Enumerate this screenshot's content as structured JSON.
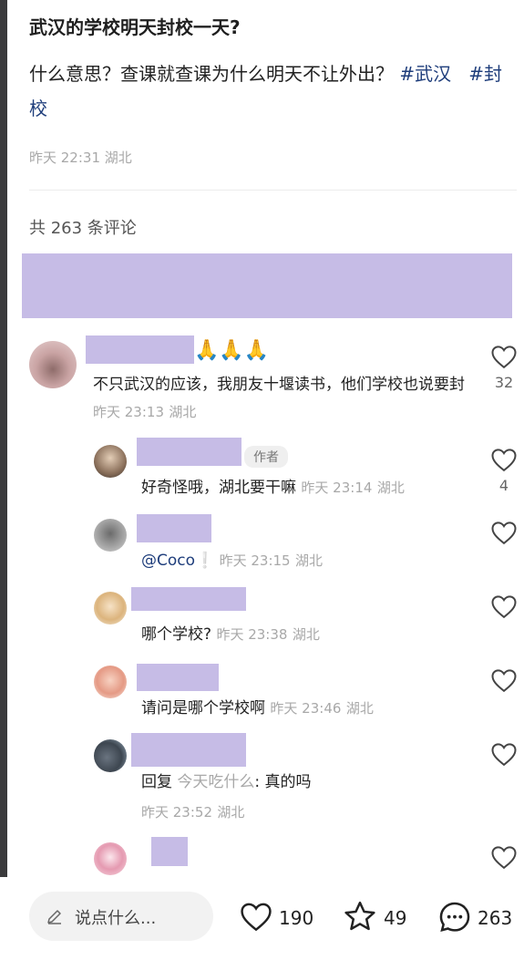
{
  "post": {
    "title": "武汉的学校明天封校一天?",
    "body_text": "什么意思？查课就查课为什么明天不让外出？",
    "tags": [
      "#武汉",
      "#封校"
    ],
    "time": "昨天 22:31",
    "location": "湖北"
  },
  "comments_header": "共 263 条评论",
  "comments": [
    {
      "name_suffix": "🙏🙏🙏",
      "text": "不只武汉的应该，我朋友十堰读书，他们学校也说要封",
      "time": "昨天 23:13",
      "location": "湖北",
      "likes": "32"
    },
    {
      "badge": "作者",
      "text": "好奇怪哦，湖北要干嘛",
      "time": "昨天 23:14",
      "location": "湖北",
      "likes": "4"
    },
    {
      "mention": "@Coco",
      "mention_suffix": "❕",
      "time": "昨天 23:15",
      "location": "湖北"
    },
    {
      "text": "哪个学校?",
      "time": "昨天 23:38",
      "location": "湖北"
    },
    {
      "text": "请问是哪个学校啊",
      "time": "昨天 23:46",
      "location": "湖北"
    },
    {
      "reply_label": "回复",
      "reply_to": "今天吃什么",
      "text": ": 真的吗",
      "time": "昨天 23:52",
      "location": "湖北"
    }
  ],
  "bottom_bar": {
    "input_placeholder": "说点什么...",
    "likes": "190",
    "favorites": "49",
    "comments": "263"
  },
  "colors": {
    "redaction": "#c6bce6",
    "tag": "#1e3d7b",
    "muted": "#a8a8a8"
  }
}
